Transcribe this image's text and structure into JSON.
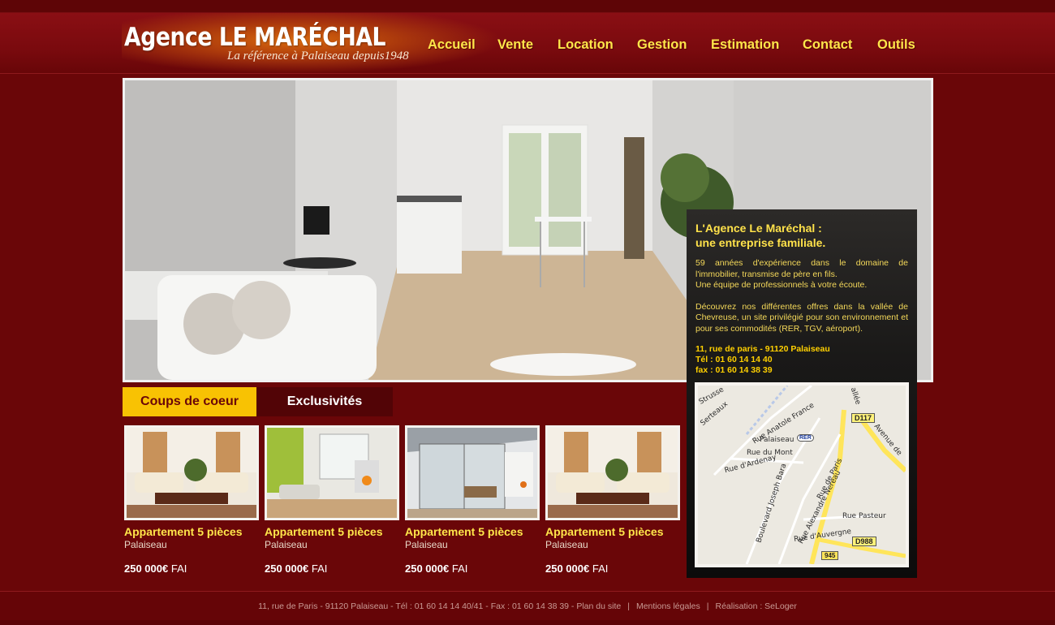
{
  "brand": {
    "title": "Agence LE MARÉCHAL",
    "tagline": "La référence à Palaiseau depuis1948"
  },
  "nav": {
    "items": [
      "Accueil",
      "Vente",
      "Location",
      "Gestion",
      "Estimation",
      "Contact",
      "Outils"
    ]
  },
  "tabs": {
    "active": "Coups de coeur",
    "inactive": "Exclusivités"
  },
  "listings": [
    {
      "title": "Appartement 5 pièces",
      "city": "Palaiseau",
      "price": "250 000€",
      "suffix": "FAI"
    },
    {
      "title": "Appartement 5 pièces",
      "city": "Palaiseau",
      "price": "250 000€",
      "suffix": "FAI"
    },
    {
      "title": "Appartement 5 pièces",
      "city": "Palaiseau",
      "price": "250 000€",
      "suffix": "FAI"
    },
    {
      "title": "Appartement 5 pièces",
      "city": "Palaiseau",
      "price": "250 000€",
      "suffix": "FAI"
    }
  ],
  "info": {
    "title_line1": "L'Agence Le Maréchal :",
    "title_line2": "une entreprise familiale.",
    "para1": "59 années d'expérience dans le domaine de l'immobilier, transmise de père en fils.",
    "para1b": "Une équipe de professionnels à votre écoute.",
    "para2": "Découvrez nos différentes offres dans la vallée de Chevreuse, un site privilégié pour son environnement et pour ses commodités (RER, TGV, aéroport).",
    "address": "11, rue de paris - 91120 Palaiseau",
    "tel": "Tél : 01 60 14 14 40",
    "fax": "fax : 01 60 14 38 39"
  },
  "map": {
    "labels": [
      "Rue Anatole France",
      "Palaiseau",
      "Rue du Mont",
      "Rue d'Ardenay",
      "Boulevard Joseph Bara",
      "Rue Alexandre Nereau",
      "Rue de Paris",
      "Rue Pasteur",
      "Rue d'Auvergne",
      "Avenue de",
      "allée",
      "Serteaux",
      "Strusse"
    ],
    "shields": [
      "D117",
      "D988",
      "RER",
      "945"
    ]
  },
  "footer": {
    "contact": "11, rue de Paris - 91120 Palaiseau - Tél : 01 60 14 14 40/41 - Fax : 01 60 14 38 39 - Plan du site",
    "legal": "Mentions légales",
    "credit": "Réalisation : SeLoger"
  },
  "colors": {
    "background": "#6a0608",
    "accent_yellow": "#ffe64a",
    "tab_active": "#f8c203",
    "tab_inactive": "#520406"
  }
}
